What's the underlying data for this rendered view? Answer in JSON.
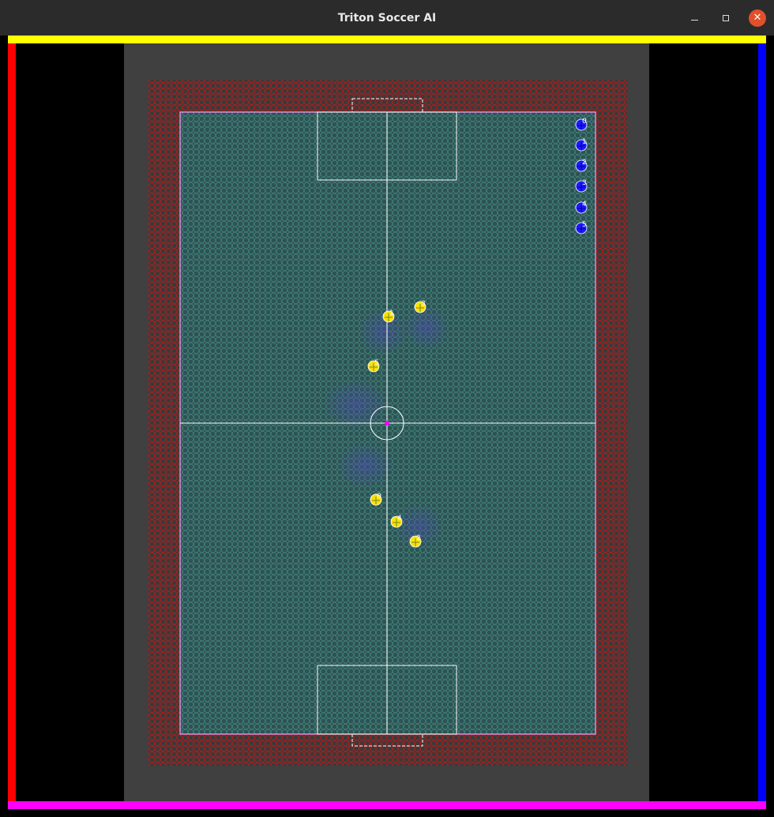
{
  "window": {
    "title": "Triton Soccer AI",
    "controls": [
      "minimize",
      "maximize",
      "close"
    ]
  },
  "colors": {
    "title_bar": "#2b2b2b",
    "border_top": "#ffff00",
    "border_left": "#ff0000",
    "border_right": "#0000ff",
    "border_bottom": "#ff00ff",
    "out_area": "#404040",
    "field_fill": "#2f5252",
    "grid_inside": "#4fb4a8",
    "grid_outside": "#b01c1c",
    "lines": "#ffffff",
    "boundary": "#ff9cff",
    "ball": "#ff00ff",
    "blue_team": "#1a1aff",
    "yellow_team": "#ffe000",
    "influence": "#4a4aaa"
  },
  "blue_team": {
    "robot_ids": [
      "0",
      "1",
      "2",
      "3",
      "4",
      "5"
    ]
  },
  "yellow_team": {
    "robot_ids": [
      "1",
      "3",
      "5",
      "0",
      "4",
      "2"
    ]
  }
}
